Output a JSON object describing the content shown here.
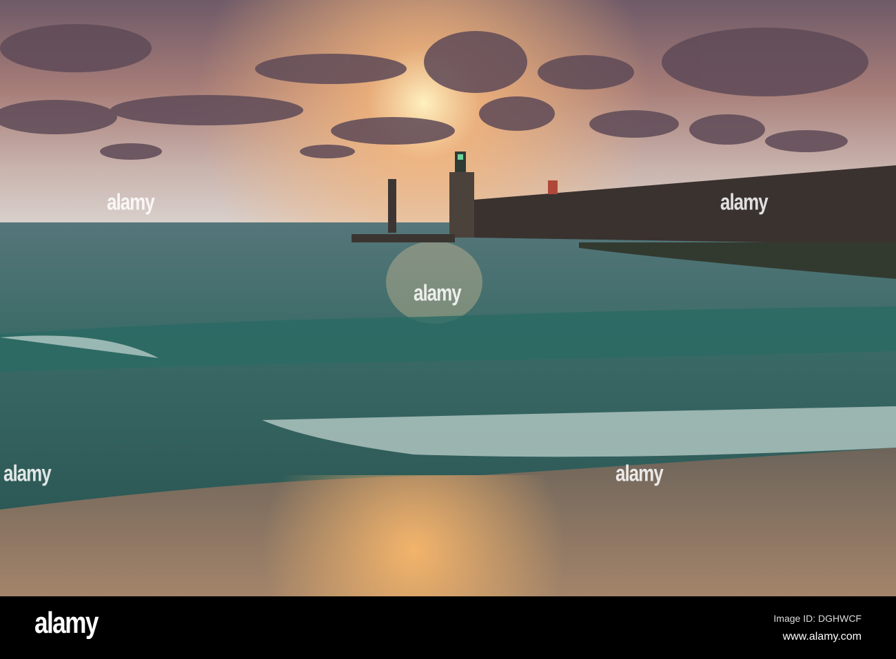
{
  "photo": {
    "description_colors": {
      "sky": "#8a6f7a",
      "sun": "#ffd89a",
      "sea": "#2f5f5c",
      "sand": "#8a7260"
    }
  },
  "watermark": {
    "text": "alamy"
  },
  "footer": {
    "logo": "alamy",
    "image_id": "Image ID: DGHWCF",
    "site": "www.alamy.com"
  }
}
